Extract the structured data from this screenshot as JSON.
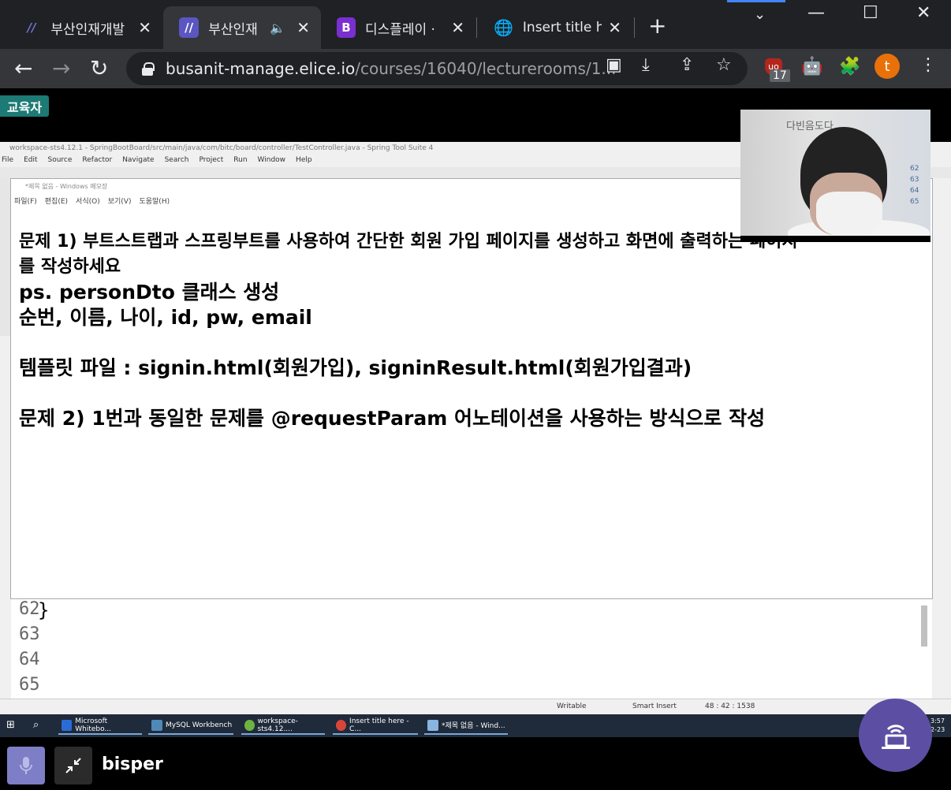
{
  "browser": {
    "tabs": [
      {
        "title": "부산인재개발",
        "favicon": "slash-logo-icon",
        "active": false
      },
      {
        "title": "부산인재",
        "favicon": "slash-logo-icon",
        "active": true,
        "audio": "speaker-icon"
      },
      {
        "title": "디스플레이 ·",
        "favicon": "bootstrap-icon",
        "active": false
      },
      {
        "title": "Insert title he",
        "favicon": "globe-icon",
        "active": false
      }
    ],
    "new_tab": "+",
    "url_domain": "busanit-manage.elice.io",
    "url_path": "/courses/16040/lecturerooms/1...",
    "extension_badge": "17",
    "profile_initial": "t"
  },
  "colors": {
    "tabbar": "#202124",
    "toolbar": "#35363a",
    "edu_badge": "#1d7a74",
    "mic_button": "#7d7ec5",
    "float_button": "#5c4fa3",
    "profile": "#e8710a"
  },
  "page": {
    "edu_badge": "교육자"
  },
  "ide": {
    "title": "workspace-sts4.12.1 - SpringBootBoard/src/main/java/com/bitc/board/controller/TestController.java - Spring Tool Suite 4",
    "menu": [
      "File",
      "Edit",
      "Source",
      "Refactor",
      "Navigate",
      "Search",
      "Project",
      "Run",
      "Window",
      "Help"
    ],
    "line_numbers": [
      "62",
      "63",
      "64",
      "65"
    ],
    "code_line_62": "}",
    "status": {
      "writable": "Writable",
      "insert": "Smart Insert",
      "position": "48 : 42 : 1538"
    }
  },
  "notepad": {
    "title": "*제목 없음 - Windows 메모장",
    "menu": [
      "파일(F)",
      "편집(E)",
      "서식(O)",
      "보기(V)",
      "도움말(H)"
    ],
    "lines": {
      "l1": "문제 1) 부트스트랩과 스프링부트를 사용하여 간단한 회원 가입 페이지를 생성하고 화면에 출력하는 페이지",
      "l2": "를 작성하세요",
      "l3": "ps. personDto 클래스 생성",
      "l4": "순번, 이름, 나이, id, pw, email",
      "l5": "템플릿 파일 : signin.html(회원가입), signinResult.html(회원가입결과)",
      "l6": "문제 2) 1번과 동일한 문제를 @requestParam 어노테이션을 사용하는 방식으로 작성"
    }
  },
  "webcam": {
    "sign_text": "다빈음도다",
    "side_numbers": [
      "62",
      "63",
      "64",
      "65"
    ]
  },
  "taskbar": {
    "items": [
      "Microsoft Whitebo...",
      "MySQL Workbench",
      "workspace-sts4.12....",
      "Insert title here - C...",
      "*제목 없음 - Wind..."
    ],
    "clock_time": "3:57",
    "clock_date": "2-23"
  },
  "call": {
    "participant": "bisper"
  }
}
